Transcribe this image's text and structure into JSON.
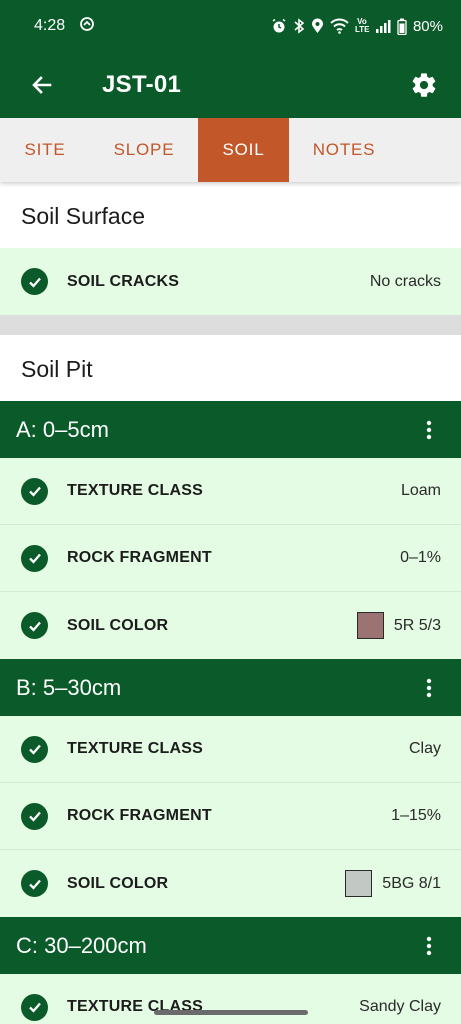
{
  "status_bar": {
    "time": "4:28",
    "battery": "80%",
    "network_label": "Vo LTE"
  },
  "app_bar": {
    "title": "JST-01",
    "back_icon": "arrow-back-icon",
    "settings_icon": "gear-icon"
  },
  "tabs": [
    {
      "label": "SITE",
      "active": false
    },
    {
      "label": "SLOPE",
      "active": false
    },
    {
      "label": "SOIL",
      "active": true
    },
    {
      "label": "NOTES",
      "active": false
    }
  ],
  "soil_surface": {
    "title": "Soil Surface",
    "rows": [
      {
        "label": "SOIL CRACKS",
        "value": "No cracks"
      }
    ]
  },
  "soil_pit": {
    "title": "Soil Pit",
    "horizons": [
      {
        "title": "A: 0–5cm",
        "rows": [
          {
            "label": "TEXTURE CLASS",
            "value": "Loam"
          },
          {
            "label": "ROCK FRAGMENT",
            "value": "0–1%"
          },
          {
            "label": "SOIL COLOR",
            "value": "5R 5/3",
            "swatch": "#9b7373"
          }
        ]
      },
      {
        "title": "B: 5–30cm",
        "rows": [
          {
            "label": "TEXTURE CLASS",
            "value": "Clay"
          },
          {
            "label": "ROCK FRAGMENT",
            "value": "1–15%"
          },
          {
            "label": "SOIL COLOR",
            "value": "5BG 8/1",
            "swatch": "#c2c9c5"
          }
        ]
      },
      {
        "title": "C: 30–200cm",
        "rows": [
          {
            "label": "TEXTURE CLASS",
            "value": "Sandy Clay"
          }
        ]
      }
    ]
  },
  "colors": {
    "primary": "#0b5b2a",
    "accent": "#c2572a",
    "row_background": "#e4fbe4"
  }
}
